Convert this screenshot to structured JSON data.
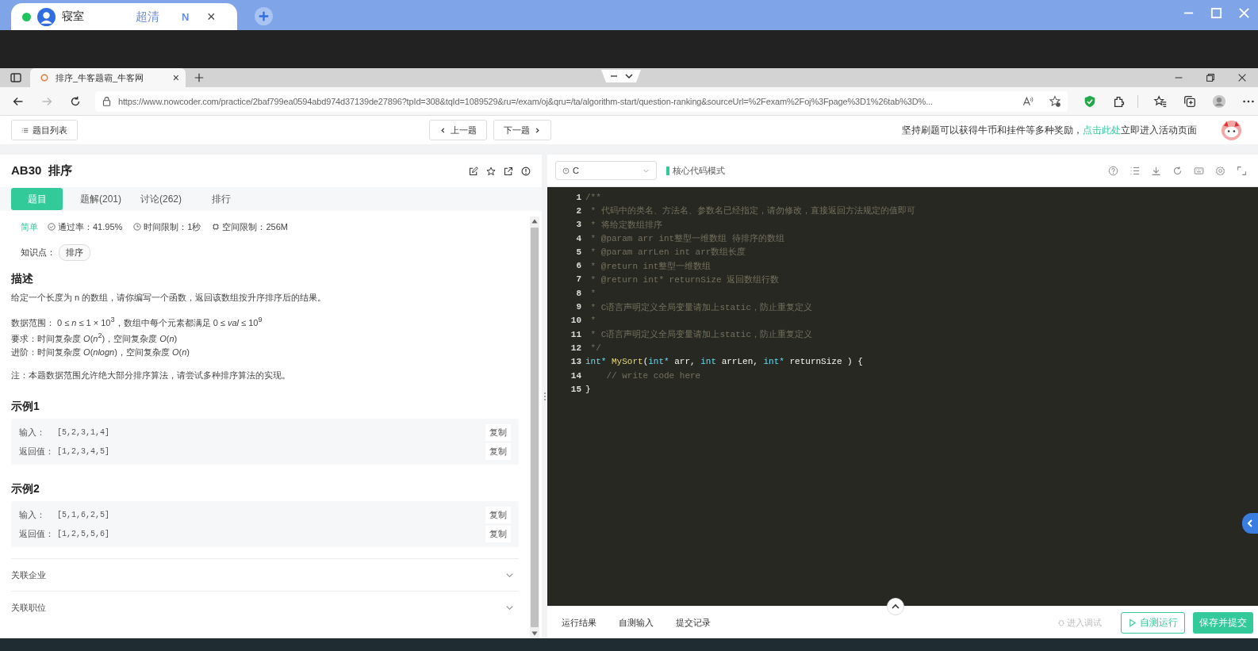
{
  "remote_tab": {
    "title": "寝室",
    "quality": "超清",
    "badge": "N",
    "close": "×"
  },
  "browser_tab": {
    "title": "排序_牛客题霸_牛客网",
    "close": "×"
  },
  "address": {
    "url": "https://www.nowcoder.com/practice/2baf799ea0594abd974d37139de27896?tpId=308&tqId=1089529&ru=/exam/oj&qru=/ta/algorithm-start/question-ranking&sourceUrl=%2Fexam%2Foj%3Fpage%3D1%26tab%3D%..."
  },
  "site_header": {
    "list_button": "题目列表",
    "prev": "上一题",
    "next": "下一题",
    "promo_before": "坚持刷题可以获得牛币和挂件等多种奖励，",
    "promo_link": "点击此处",
    "promo_after": "立即进入活动页面"
  },
  "problem": {
    "title": "AB30  排序",
    "tabs": [
      {
        "label": "题目",
        "selected": true
      },
      {
        "label": "题解(201)",
        "selected": false
      },
      {
        "label": "讨论(262)",
        "selected": false
      },
      {
        "label": "排行",
        "selected": false
      }
    ],
    "difficulty": "简单",
    "pass_rate": "通过率：41.95%",
    "time_limit": "时间限制：1秒",
    "space_limit": "空间限制：256M",
    "topics_label": "知识点：",
    "topics": [
      "排序"
    ],
    "description_heading": "描述",
    "paragraphs": [
      "给定一个长度为 n 的数组，请你编写一个函数，返回该数组按升序排序后的结果。",
      "数据范围： 0 ≤ *n* ≤ 1 × 10$^{3}$，数组中每个元素都满足 0 ≤ *val* ≤ 10$^{9}$",
      "要求：时间复杂度 *O*(*n*$^{2}$)，空间复杂度 *O*(*n*)",
      "进阶：时间复杂度 *O*(*nlogn*)，空间复杂度 *O*(*n*)",
      "注：本题数据范围允许绝大部分排序算法，请尝试多种排序算法的实现。"
    ],
    "examples": [
      {
        "heading": "示例1",
        "rows": [
          {
            "label": "输入：",
            "value": "[5,2,3,1,4]",
            "copy": "复制"
          },
          {
            "label": "返回值：",
            "value": "[1,2,3,4,5]",
            "copy": "复制"
          }
        ]
      },
      {
        "heading": "示例2",
        "rows": [
          {
            "label": "输入：",
            "value": "[5,1,6,2,5]",
            "copy": "复制"
          },
          {
            "label": "返回值：",
            "value": "[1,2,5,5,6]",
            "copy": "复制"
          }
        ]
      }
    ],
    "related": [
      "关联企业",
      "关联职位"
    ]
  },
  "editor": {
    "language": "C",
    "mode": "核心代码模式",
    "lines": [
      {
        "number": "1",
        "segments": [
          {
            "kind": "comment",
            "text": "/**"
          }
        ]
      },
      {
        "number": "2",
        "segments": [
          {
            "kind": "comment",
            "text": " * 代码中的类名、方法名、参数名已经指定，请勿修改，直接返回方法规定的值即可"
          }
        ]
      },
      {
        "number": "3",
        "segments": [
          {
            "kind": "comment",
            "text": " * 将给定数组排序"
          }
        ]
      },
      {
        "number": "4",
        "segments": [
          {
            "kind": "comment",
            "text": " * @param arr int整型一维数组 待排序的数组"
          }
        ]
      },
      {
        "number": "5",
        "segments": [
          {
            "kind": "comment",
            "text": " * @param arrLen int arr数组长度"
          }
        ]
      },
      {
        "number": "6",
        "segments": [
          {
            "kind": "comment",
            "text": " * @return int整型一维数组"
          }
        ]
      },
      {
        "number": "7",
        "segments": [
          {
            "kind": "comment",
            "text": " * @return int* returnSize 返回数组行数"
          }
        ]
      },
      {
        "number": "8",
        "segments": [
          {
            "kind": "comment",
            "text": " *"
          }
        ]
      },
      {
        "number": "9",
        "segments": [
          {
            "kind": "comment",
            "text": " * C语言声明定义全局变量请加上static，防止重复定义"
          }
        ]
      },
      {
        "number": "10",
        "segments": [
          {
            "kind": "comment",
            "text": " *"
          }
        ]
      },
      {
        "number": "11",
        "segments": [
          {
            "kind": "comment",
            "text": " * C语言声明定义全局变量请加上static，防止重复定义"
          }
        ]
      },
      {
        "number": "12",
        "segments": [
          {
            "kind": "comment",
            "text": " */"
          }
        ]
      },
      {
        "number": "13",
        "segments": [
          {
            "kind": "keyword",
            "text": "int* "
          },
          {
            "kind": "function",
            "text": "MySort"
          },
          {
            "kind": "plain",
            "text": "("
          },
          {
            "kind": "keyword",
            "text": "int*"
          },
          {
            "kind": "plain",
            "text": " arr, "
          },
          {
            "kind": "keyword",
            "text": "int"
          },
          {
            "kind": "plain",
            "text": " arrLen, "
          },
          {
            "kind": "keyword",
            "text": "int*"
          },
          {
            "kind": "plain",
            "text": " returnSize ) {"
          }
        ]
      },
      {
        "number": "14",
        "segments": [
          {
            "kind": "comment",
            "text": "    // write code here"
          }
        ]
      },
      {
        "number": "15",
        "segments": [
          {
            "kind": "plain",
            "text": "}"
          }
        ]
      }
    ],
    "bottom_tabs": [
      "运行结果",
      "自测输入",
      "提交记录"
    ],
    "debug": "进入调试",
    "run": "自测运行",
    "submit": "保存并提交"
  }
}
